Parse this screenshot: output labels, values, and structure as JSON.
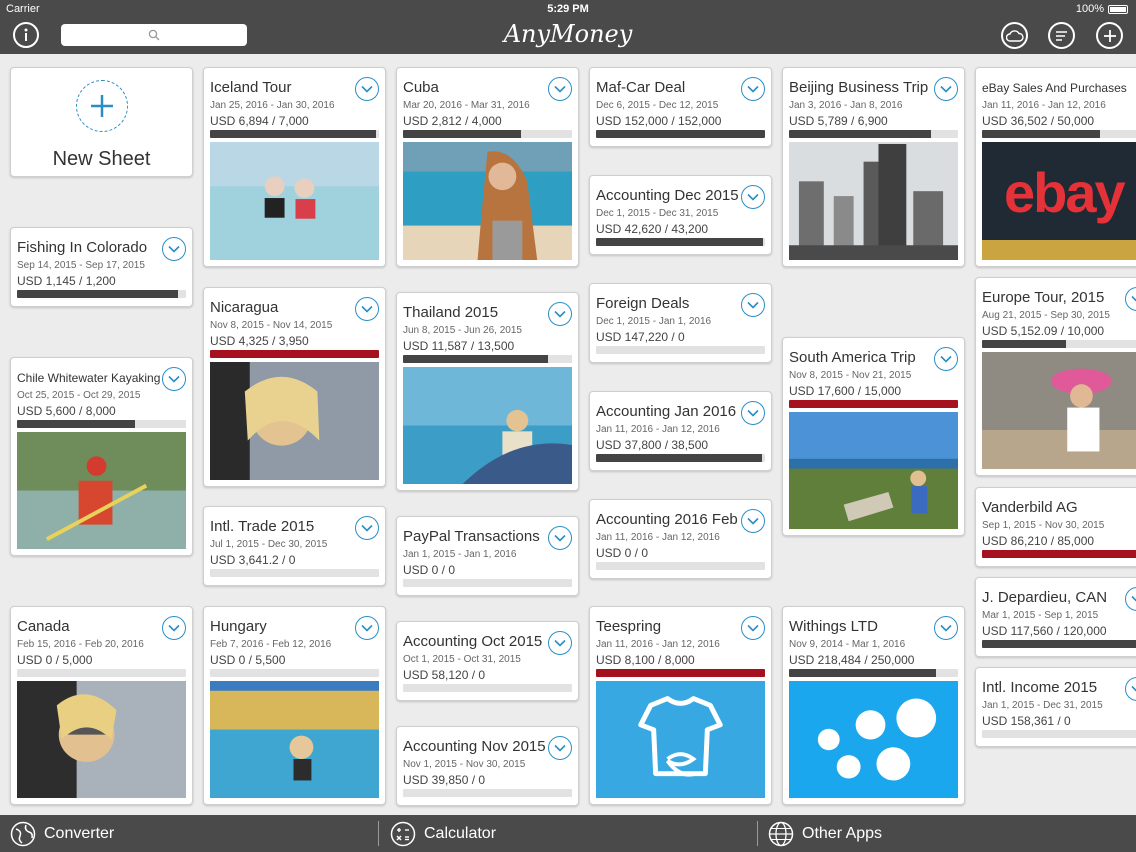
{
  "status": {
    "carrier": "Carrier",
    "time": "5:29 PM",
    "battery": "100%"
  },
  "app": {
    "title": "AnyMoney",
    "new_sheet": "New Sheet"
  },
  "search": {
    "placeholder": ""
  },
  "colors": {
    "accent": "#2a8ec6",
    "over_budget": "#a5111e",
    "progress": "#444444",
    "chrome": "#4a4a4a"
  },
  "cards": {
    "iceland": {
      "title": "Iceland Tour",
      "dates": "Jan 25, 2016 - Jan 30, 2016",
      "amount": "USD 6,894 / 7,000",
      "progress": 0.98
    },
    "cuba": {
      "title": "Cuba",
      "dates": "Mar 20, 2016 - Mar 31, 2016",
      "amount": "USD 2,812 / 4,000",
      "progress": 0.7
    },
    "mafcar": {
      "title": "Maf-Car Deal",
      "dates": "Dec 6, 2015 - Dec 12, 2015",
      "amount": "USD 152,000 / 152,000",
      "progress": 1.0
    },
    "beijing": {
      "title": "Beijing Business Trip",
      "dates": "Jan 3, 2016 - Jan 8, 2016",
      "amount": "USD 5,789 / 6,900",
      "progress": 0.84
    },
    "ebay": {
      "title": "eBay Sales And Purchases",
      "dates": "Jan 11, 2016 - Jan 12, 2016",
      "amount": "USD 36,502 / 50,000",
      "progress": 0.73
    },
    "fishing": {
      "title": "Fishing In Colorado",
      "dates": "Sep 14, 2015 - Sep 17, 2015",
      "amount": "USD 1,145 / 1,200",
      "progress": 0.95
    },
    "accdec": {
      "title": "Accounting Dec 2015",
      "dates": "Dec 1, 2015 - Dec 31, 2015",
      "amount": "USD 42,620 / 43,200",
      "progress": 0.99
    },
    "nicaragua": {
      "title": "Nicaragua",
      "dates": "Nov 8, 2015 - Nov 14, 2015",
      "amount": "USD 4,325 / 3,950",
      "progress": 1.0
    },
    "thailand": {
      "title": "Thailand 2015",
      "dates": "Jun 8, 2015 - Jun 26, 2015",
      "amount": "USD 11,587 / 13,500",
      "progress": 0.86
    },
    "foreign": {
      "title": "Foreign Deals",
      "dates": "Dec 1, 2015 - Jan 1, 2016",
      "amount": "USD 147,220 / 0",
      "progress": 0
    },
    "europe": {
      "title": "Europe Tour, 2015",
      "dates": "Aug 21, 2015 - Sep 30, 2015",
      "amount": "USD 5,152.09 / 10,000",
      "progress": 0.52
    },
    "southam": {
      "title": "South America Trip",
      "dates": "Nov 8, 2015 - Nov 21, 2015",
      "amount": "USD 17,600 / 15,000",
      "progress": 1.0
    },
    "chile": {
      "title": "Chile Whitewater Kayaking",
      "dates": "Oct 25, 2015 - Oct 29, 2015",
      "amount": "USD 5,600 / 8,000",
      "progress": 0.7
    },
    "accjan": {
      "title": "Accounting Jan 2016",
      "dates": "Jan 11, 2016 - Jan 12, 2016",
      "amount": "USD 37,800 / 38,500",
      "progress": 0.98
    },
    "vanderbild": {
      "title": "Vanderbild AG",
      "dates": "Sep 1, 2015 - Nov 30, 2015",
      "amount": "USD 86,210 / 85,000",
      "progress": 1.0
    },
    "intltrade": {
      "title": "Intl. Trade 2015",
      "dates": "Jul 1, 2015 - Dec 30, 2015",
      "amount": "USD 3,641.2 / 0",
      "progress": 0
    },
    "paypal": {
      "title": "PayPal Transactions",
      "dates": "Jan 1, 2015 - Jan 1, 2016",
      "amount": "USD 0 / 0",
      "progress": 0
    },
    "accfeb": {
      "title": "Accounting 2016 Feb",
      "dates": "Jan 11, 2016 - Jan 12, 2016",
      "amount": "USD 0 / 0",
      "progress": 0
    },
    "depardieu": {
      "title": "J. Depardieu, CAN",
      "dates": "Mar 1, 2015 - Sep 1, 2015",
      "amount": "USD 117,560 / 120,000",
      "progress": 0.98
    },
    "canada": {
      "title": "Canada",
      "dates": "Feb 15, 2016 - Feb 20, 2016",
      "amount": "USD 0 / 5,000",
      "progress": 0
    },
    "hungary": {
      "title": "Hungary",
      "dates": "Feb 7, 2016 - Feb 12, 2016",
      "amount": "USD 0 / 5,500",
      "progress": 0
    },
    "accoct": {
      "title": "Accounting Oct 2015",
      "dates": "Oct 1, 2015 - Oct 31, 2015",
      "amount": "USD 58,120 / 0",
      "progress": 0
    },
    "teespring": {
      "title": "Teespring",
      "dates": "Jan 11, 2016 - Jan 12, 2016",
      "amount": "USD 8,100 / 8,000",
      "progress": 1.0
    },
    "withings": {
      "title": "Withings LTD",
      "dates": "Nov 9, 2014 - Mar 1, 2016",
      "amount": "USD 218,484 / 250,000",
      "progress": 0.87
    },
    "intlincome": {
      "title": "Intl. Income 2015",
      "dates": "Jan 1, 2015 - Dec 31, 2015",
      "amount": "USD 158,361 / 0",
      "progress": 0
    },
    "accnov": {
      "title": "Accounting Nov 2015",
      "dates": "Nov 1, 2015 - Nov 30, 2015",
      "amount": "USD 39,850 / 0",
      "progress": 0
    }
  },
  "photo_text": {
    "ebay": "ebay"
  },
  "bottom": {
    "converter": "Converter",
    "calculator": "Calculator",
    "other_apps": "Other Apps"
  }
}
